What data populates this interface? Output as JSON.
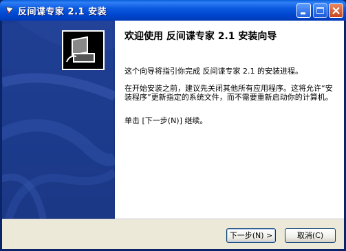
{
  "window": {
    "title": "反间谍专家 2.1 安装"
  },
  "welcome": {
    "heading": "欢迎使用 反间谍专家 2.1 安装向导",
    "paragraph1": "这个向导将指引你完成 反间谍专家 2.1 的安装进程。",
    "paragraph2": "在开始安装之前，建议先关闭其他所有应用程序。这将允许“安装程序”更新指定的系统文件，而不需要重新启动你的计算机。",
    "paragraph3": "单击 [下一步(N)] 继续。"
  },
  "buttons": {
    "next": "下一步(N) >",
    "cancel": "取消(C)"
  },
  "colors": {
    "titlebar": "#0054e3",
    "sidebar": "#1c3a8c",
    "dialog_bg": "#ece9d8"
  }
}
